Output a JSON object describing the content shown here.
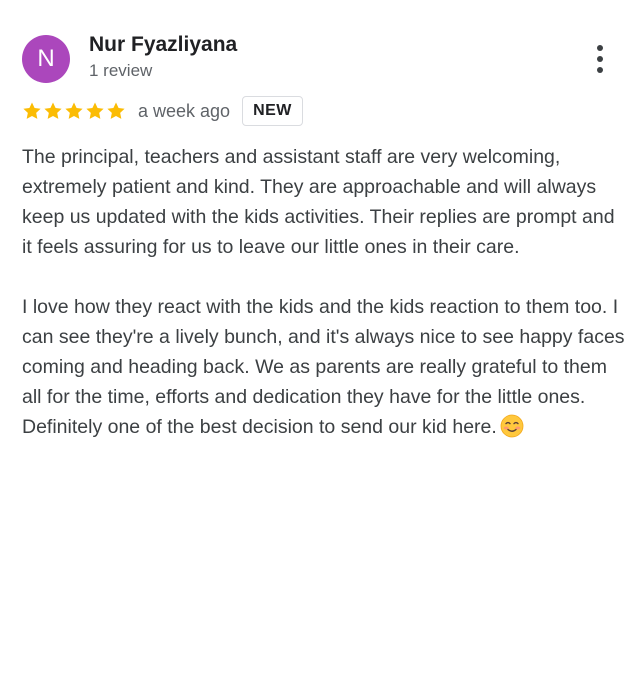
{
  "reviewer": {
    "initial": "N",
    "name": "Nur Fyazliyana",
    "review_count": "1 review",
    "avatar_color": "#ab47bc"
  },
  "rating": {
    "stars": 5,
    "max_stars": 5,
    "star_color": "#fbbc04"
  },
  "time_ago": "a week ago",
  "badge": "NEW",
  "more_menu_icon": "more-vert-icon",
  "review": {
    "paragraph_1": "The principal, teachers and assistant staff are very welcoming, extremely patient and kind. They are approachable and will always keep us updated with the kids activities. Their replies are prompt and it feels assuring for us to leave our little ones in their care.",
    "paragraph_2": "I love how they react with the kids and the kids reaction to them too. I can see they're a lively bunch, and it's always nice to see happy faces coming and heading back. We as parents are really grateful to them all for the time, efforts and dedication they have for the little ones. Definitely one of the best decision to send our kid here.",
    "emoji": "smiling-face-emoji"
  }
}
